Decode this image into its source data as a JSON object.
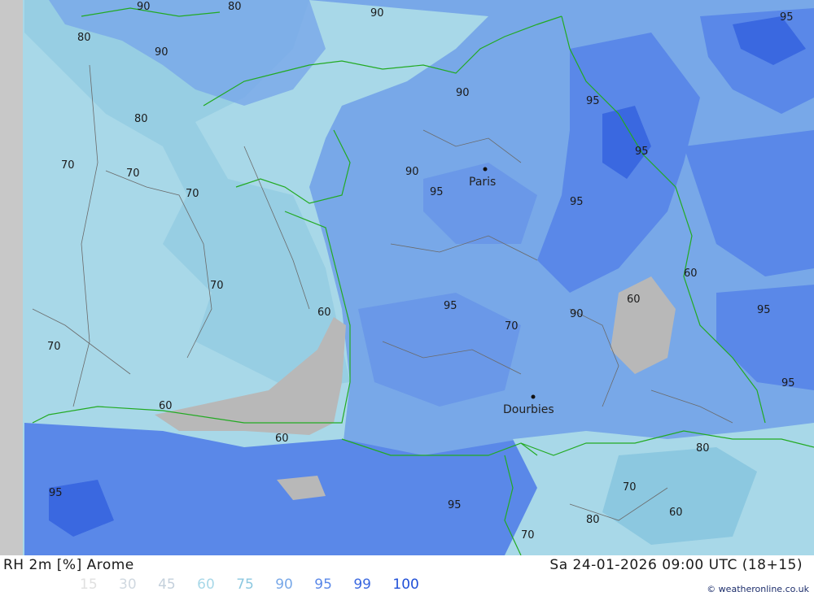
{
  "map": {
    "cities": [
      {
        "name": "Paris"
      },
      {
        "name": "Dourbies"
      }
    ],
    "contour_labels": [
      "60",
      "70",
      "80",
      "90",
      "95"
    ]
  },
  "footer": {
    "title": "RH 2m [%] Arome",
    "datetime": "Sa 24-01-2026 09:00 UTC (18+15)",
    "credit": "© weatheronline.co.uk",
    "legend": [
      {
        "value": "15",
        "color": "#e0e0e0"
      },
      {
        "value": "30",
        "color": "#d0d8e0"
      },
      {
        "value": "45",
        "color": "#c4d0dc"
      },
      {
        "value": "60",
        "color": "#a8d8e8"
      },
      {
        "value": "75",
        "color": "#8cc8e0"
      },
      {
        "value": "90",
        "color": "#78a8e8"
      },
      {
        "value": "95",
        "color": "#5a88e8"
      },
      {
        "value": "99",
        "color": "#3a68e0"
      },
      {
        "value": "100",
        "color": "#2050d8"
      }
    ]
  }
}
